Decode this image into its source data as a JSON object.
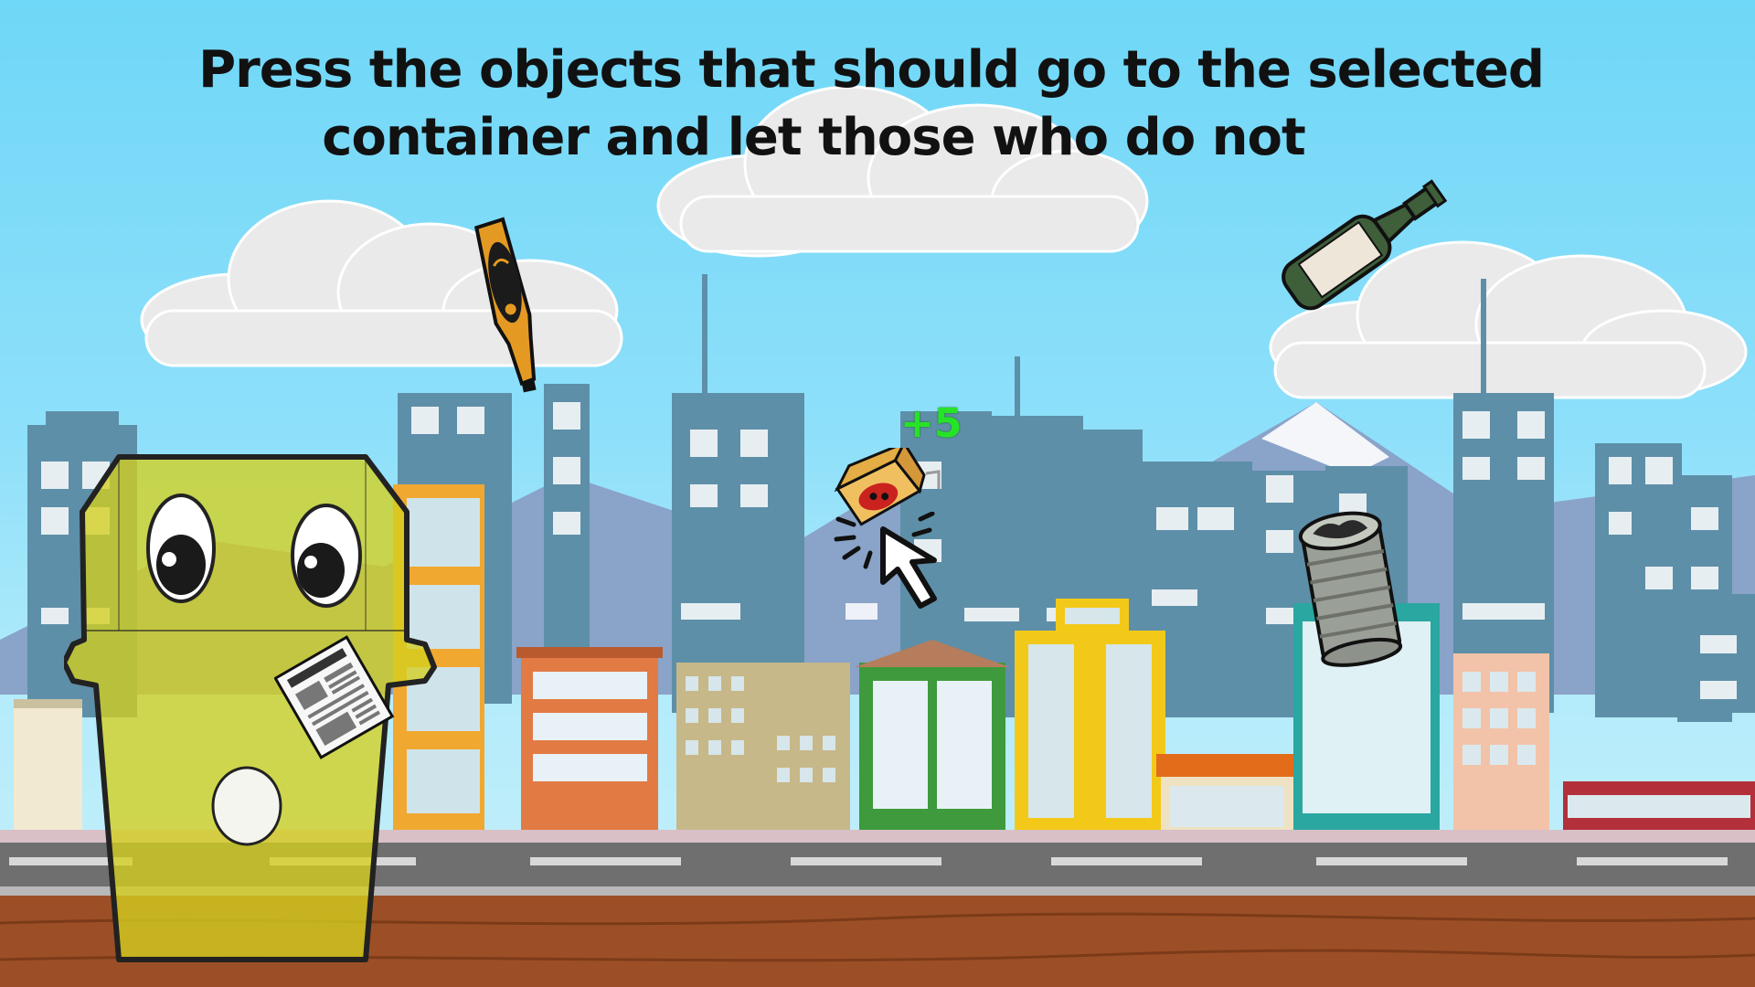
{
  "instruction": {
    "line1": "Press the objects that should go to the selected",
    "line2": "container and let those who do not"
  },
  "score_popup": "+5",
  "selected_container": {
    "type": "yellow-bin",
    "color": "#d4cf1e"
  },
  "falling_objects": [
    {
      "name": "beer-bottle",
      "kind": "glass"
    },
    {
      "name": "wine-bottle",
      "kind": "glass"
    },
    {
      "name": "juice-carton",
      "kind": "brick"
    },
    {
      "name": "tin-can",
      "kind": "metal"
    },
    {
      "name": "newspaper",
      "kind": "paper"
    }
  ],
  "cursor": "arrow-cursor",
  "colors": {
    "sky": "#6fd7f7",
    "buildings": "#5e8fa8",
    "road": "#6f6f6f",
    "floor": "#9c4f26",
    "score": "#27e327"
  }
}
